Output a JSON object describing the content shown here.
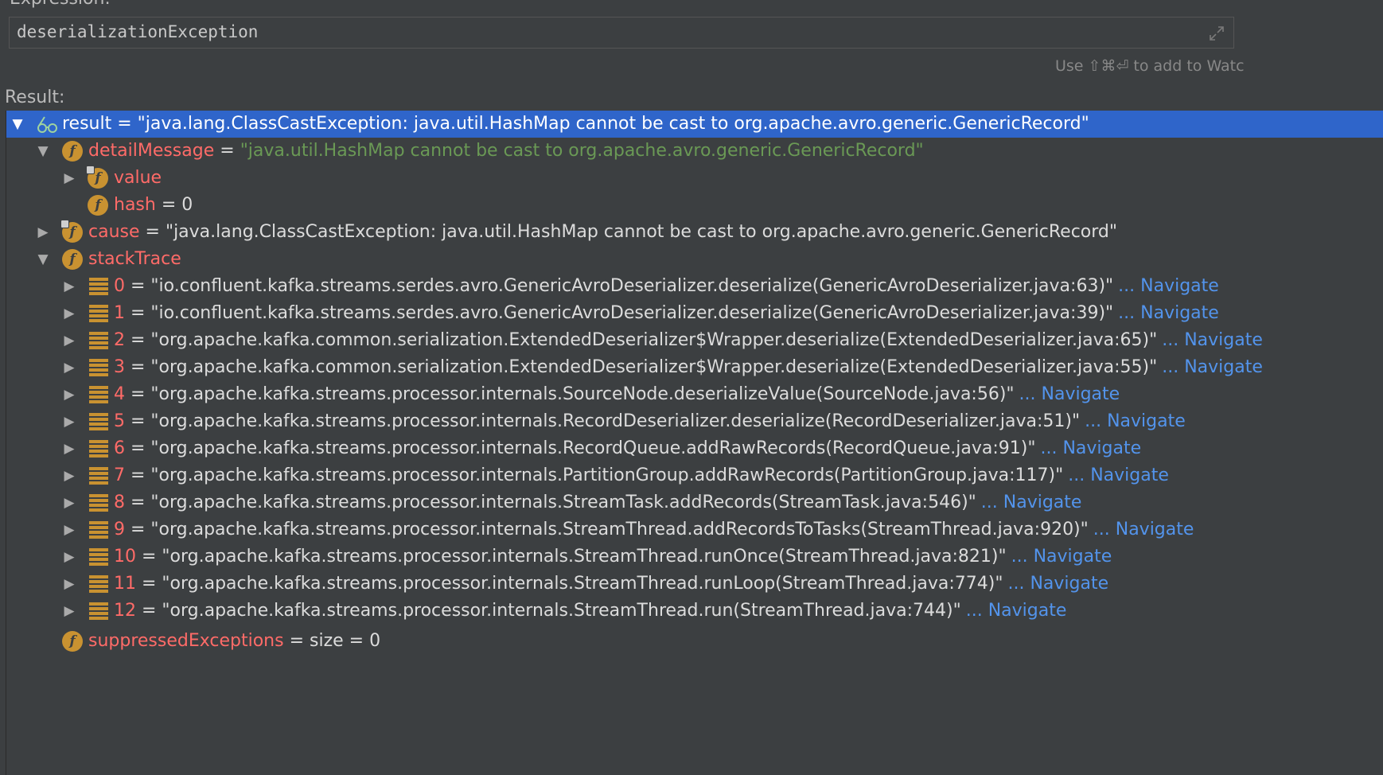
{
  "expression": {
    "value": "deserializationException",
    "top_label": "Expression:",
    "expand_icon": "expand-icon"
  },
  "hint": "Use ⇧⌘⏎ to add to Watc",
  "result_label": "Result:",
  "tree": {
    "result": {
      "name": "result",
      "value": " = \"java.lang.ClassCastException: java.util.HashMap cannot be cast to org.apache.avro.generic.GenericRecord\""
    },
    "detailMessage": {
      "name": "detailMessage",
      "eq": " = ",
      "value": "\"java.util.HashMap cannot be cast to org.apache.avro.generic.GenericRecord\""
    },
    "value_field": {
      "name": "value"
    },
    "hash_field": {
      "name": "hash",
      "value": " = 0"
    },
    "cause": {
      "name": "cause",
      "value": " = \"java.lang.ClassCastException: java.util.HashMap cannot be cast to org.apache.avro.generic.GenericRecord\""
    },
    "stackTrace": {
      "name": "stackTrace"
    },
    "suppressed": {
      "name": "suppressedExceptions",
      "value": " =  size = 0"
    },
    "navigate_label": "... Navigate",
    "frames": [
      {
        "index": "0",
        "value": " = \"io.confluent.kafka.streams.serdes.avro.GenericAvroDeserializer.deserialize(GenericAvroDeserializer.java:63)\""
      },
      {
        "index": "1",
        "value": " = \"io.confluent.kafka.streams.serdes.avro.GenericAvroDeserializer.deserialize(GenericAvroDeserializer.java:39)\""
      },
      {
        "index": "2",
        "value": " = \"org.apache.kafka.common.serialization.ExtendedDeserializer$Wrapper.deserialize(ExtendedDeserializer.java:65)\""
      },
      {
        "index": "3",
        "value": " = \"org.apache.kafka.common.serialization.ExtendedDeserializer$Wrapper.deserialize(ExtendedDeserializer.java:55)\""
      },
      {
        "index": "4",
        "value": " = \"org.apache.kafka.streams.processor.internals.SourceNode.deserializeValue(SourceNode.java:56)\""
      },
      {
        "index": "5",
        "value": " = \"org.apache.kafka.streams.processor.internals.RecordDeserializer.deserialize(RecordDeserializer.java:51)\""
      },
      {
        "index": "6",
        "value": " = \"org.apache.kafka.streams.processor.internals.RecordQueue.addRawRecords(RecordQueue.java:91)\""
      },
      {
        "index": "7",
        "value": " = \"org.apache.kafka.streams.processor.internals.PartitionGroup.addRawRecords(PartitionGroup.java:117)\""
      },
      {
        "index": "8",
        "value": " = \"org.apache.kafka.streams.processor.internals.StreamTask.addRecords(StreamTask.java:546)\""
      },
      {
        "index": "9",
        "value": " = \"org.apache.kafka.streams.processor.internals.StreamThread.addRecordsToTasks(StreamThread.java:920)\""
      },
      {
        "index": "10",
        "value": " = \"org.apache.kafka.streams.processor.internals.StreamThread.runOnce(StreamThread.java:821)\""
      },
      {
        "index": "11",
        "value": " = \"org.apache.kafka.streams.processor.internals.StreamThread.runLoop(StreamThread.java:774)\""
      },
      {
        "index": "12",
        "value": " = \"org.apache.kafka.streams.processor.internals.StreamThread.run(StreamThread.java:744)\""
      }
    ]
  },
  "colors": {
    "background": "#3c3f41",
    "selection": "#2f65ca",
    "field_name": "#ff6b68",
    "string_value": "#6a9955",
    "link": "#5394ec",
    "field_icon": "#c99231"
  }
}
